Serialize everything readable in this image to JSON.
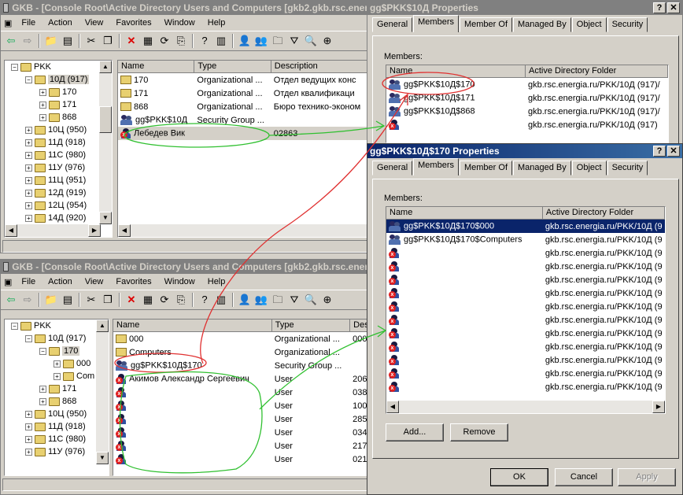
{
  "mmc1": {
    "title": "GKB - [Console Root\\Active Directory Users and Computers [gkb2.gkb.rsc.ener",
    "menu": [
      "File",
      "Action",
      "View",
      "Favorites",
      "Window",
      "Help"
    ],
    "tree": [
      {
        "label": "PKK",
        "indent": 1,
        "expander": "-"
      },
      {
        "label": "10Д (917)",
        "indent": 2,
        "expander": "-",
        "selected": true
      },
      {
        "label": "170",
        "indent": 3,
        "expander": "+"
      },
      {
        "label": "171",
        "indent": 3,
        "expander": "+"
      },
      {
        "label": "868",
        "indent": 3,
        "expander": "+"
      },
      {
        "label": "10Ц (950)",
        "indent": 2,
        "expander": "+"
      },
      {
        "label": "11Д (918)",
        "indent": 2,
        "expander": "+"
      },
      {
        "label": "11С (980)",
        "indent": 2,
        "expander": "+"
      },
      {
        "label": "11У (976)",
        "indent": 2,
        "expander": "+"
      },
      {
        "label": "11Ц (951)",
        "indent": 2,
        "expander": "+"
      },
      {
        "label": "12Д (919)",
        "indent": 2,
        "expander": "+"
      },
      {
        "label": "12Ц (954)",
        "indent": 2,
        "expander": "+"
      },
      {
        "label": "14Д (920)",
        "indent": 2,
        "expander": "+"
      }
    ],
    "columns": [
      "Name",
      "Type",
      "Description"
    ],
    "rows": [
      {
        "icon": "folder",
        "name": "170",
        "type": "Organizational ...",
        "desc": "Отдел ведущих конс"
      },
      {
        "icon": "folder",
        "name": "171",
        "type": "Organizational ...",
        "desc": "Отдел квалификаци"
      },
      {
        "icon": "folder",
        "name": "868",
        "type": "Organizational ...",
        "desc": "Бюро технико-эконом"
      },
      {
        "icon": "group",
        "name": "gg$PKK$10Д",
        "type": "Security Group ...",
        "desc": ""
      },
      {
        "icon": "user-disabled",
        "name": "Лебедев Вик",
        "type": "",
        "desc": "02863",
        "graysel": true
      }
    ]
  },
  "mmc2": {
    "title": "GKB - [Console Root\\Active Directory Users and Computers [gkb2.gkb.rsc.ener",
    "menu": [
      "File",
      "Action",
      "View",
      "Favorites",
      "Window",
      "Help"
    ],
    "tree": [
      {
        "label": "PKK",
        "indent": 1,
        "expander": "-"
      },
      {
        "label": "10Д (917)",
        "indent": 2,
        "expander": "-"
      },
      {
        "label": "170",
        "indent": 3,
        "expander": "-",
        "selected": true
      },
      {
        "label": "000",
        "indent": 4,
        "expander": "+"
      },
      {
        "label": "Com",
        "indent": 4,
        "expander": "+"
      },
      {
        "label": "171",
        "indent": 3,
        "expander": "+"
      },
      {
        "label": "868",
        "indent": 3,
        "expander": "+"
      },
      {
        "label": "10Ц (950)",
        "indent": 2,
        "expander": "+"
      },
      {
        "label": "11Д (918)",
        "indent": 2,
        "expander": "+"
      },
      {
        "label": "11С (980)",
        "indent": 2,
        "expander": "+"
      },
      {
        "label": "11У (976)",
        "indent": 2,
        "expander": "+"
      }
    ],
    "columns": [
      "Name",
      "Type",
      "Des"
    ],
    "rows": [
      {
        "icon": "folder",
        "name": "000",
        "type": "Organizational ...",
        "desc": "000"
      },
      {
        "icon": "folder",
        "name": "Computers",
        "type": "Organizational ...",
        "desc": ""
      },
      {
        "icon": "group",
        "name": "gg$PKK$10Д$170",
        "type": "Security Group ...",
        "desc": ""
      },
      {
        "icon": "user-disabled",
        "name": "Акимов Александр Сергеевич",
        "type": "User",
        "desc": "206"
      },
      {
        "icon": "user-disabled",
        "name": "",
        "type": "User",
        "desc": "038"
      },
      {
        "icon": "user-disabled",
        "name": "",
        "type": "User",
        "desc": "100"
      },
      {
        "icon": "user-disabled",
        "name": "",
        "type": "User",
        "desc": "285"
      },
      {
        "icon": "user-disabled",
        "name": "",
        "type": "User",
        "desc": "034"
      },
      {
        "icon": "user-disabled",
        "name": "",
        "type": "User",
        "desc": "217"
      },
      {
        "icon": "user-disabled",
        "name": "",
        "type": "User",
        "desc": "021"
      }
    ]
  },
  "props1": {
    "title": "gg$PKK$10Д Properties",
    "tabs": [
      "General",
      "Members",
      "Member Of",
      "Managed By",
      "Object",
      "Security"
    ],
    "active_tab": "Members",
    "members_label": "Members:",
    "columns": [
      "Name",
      "Active Directory Folder"
    ],
    "rows": [
      {
        "icon": "group",
        "name": "gg$PKK$10Д$170",
        "folder": "gkb.rsc.energia.ru/PKK/10Д (917)/"
      },
      {
        "icon": "group",
        "name": "gg$PKK$10Д$171",
        "folder": "gkb.rsc.energia.ru/PKK/10Д (917)/"
      },
      {
        "icon": "group",
        "name": "gg$PKK$10Д$868",
        "folder": "gkb.rsc.energia.ru/PKK/10Д (917)/"
      },
      {
        "icon": "user-disabled",
        "name": "",
        "folder": "gkb.rsc.energia.ru/PKK/10Д (917)"
      }
    ]
  },
  "props2": {
    "title": "gg$PKK$10Д$170 Properties",
    "tabs": [
      "General",
      "Members",
      "Member Of",
      "Managed By",
      "Object",
      "Security"
    ],
    "active_tab": "Members",
    "members_label": "Members:",
    "columns": [
      "Name",
      "Active Directory Folder"
    ],
    "rows": [
      {
        "icon": "group",
        "name": "gg$PKK$10Д$170$000",
        "folder": "gkb.rsc.energia.ru/PKK/10Д (9",
        "selected": true
      },
      {
        "icon": "group",
        "name": "gg$PKK$10Д$170$Computers",
        "folder": "gkb.rsc.energia.ru/PKK/10Д (9"
      },
      {
        "icon": "user-disabled",
        "name": "",
        "folder": "gkb.rsc.energia.ru/PKK/10Д (9"
      },
      {
        "icon": "user-disabled",
        "name": "",
        "folder": "gkb.rsc.energia.ru/PKK/10Д (9"
      },
      {
        "icon": "user-disabled",
        "name": "",
        "folder": "gkb.rsc.energia.ru/PKK/10Д (9"
      },
      {
        "icon": "user-disabled",
        "name": "",
        "folder": "gkb.rsc.energia.ru/PKK/10Д (9"
      },
      {
        "icon": "user-disabled",
        "name": "",
        "folder": "gkb.rsc.energia.ru/PKK/10Д (9"
      },
      {
        "icon": "user-disabled",
        "name": "",
        "folder": "gkb.rsc.energia.ru/PKK/10Д (9"
      },
      {
        "icon": "user-disabled",
        "name": "",
        "folder": "gkb.rsc.energia.ru/PKK/10Д (9"
      },
      {
        "icon": "user-disabled",
        "name": "",
        "folder": "gkb.rsc.energia.ru/PKK/10Д (9"
      },
      {
        "icon": "user-disabled",
        "name": "",
        "folder": "gkb.rsc.energia.ru/PKK/10Д (9"
      },
      {
        "icon": "user-disabled",
        "name": "",
        "folder": "gkb.rsc.energia.ru/PKK/10Д (9"
      },
      {
        "icon": "user-disabled",
        "name": "",
        "folder": "gkb.rsc.energia.ru/PKK/10Д (9"
      }
    ],
    "buttons": {
      "add": "Add...",
      "remove": "Remove"
    },
    "footer": {
      "ok": "OK",
      "cancel": "Cancel",
      "apply": "Apply"
    }
  }
}
